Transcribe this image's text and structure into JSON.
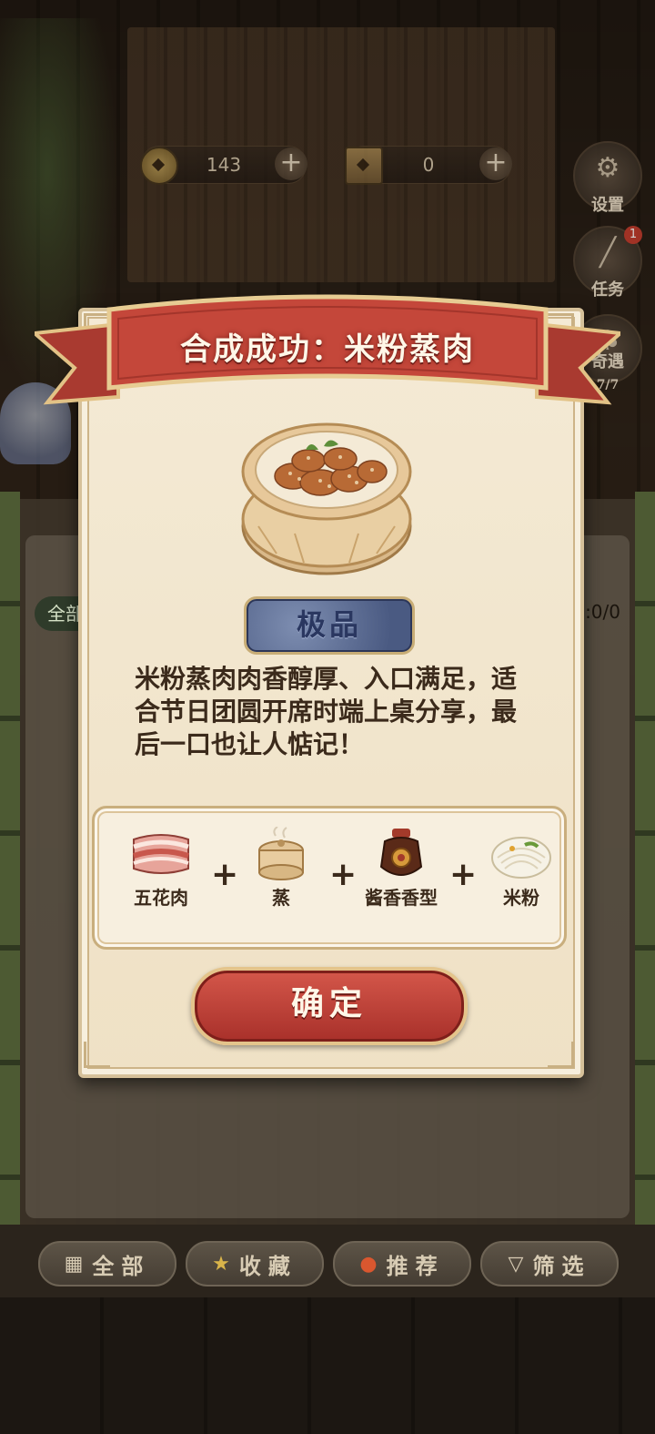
{
  "top_bar": {
    "coins": "143",
    "books": "0"
  },
  "side_buttons": {
    "settings_label": "设置",
    "tasks_label": "任务",
    "tasks_badge": "1",
    "encounter_label": "奇遇",
    "encounter_progress": "7/7"
  },
  "background_panel": {
    "tab_label": "全部",
    "count": ":0/0"
  },
  "modal": {
    "title": "合成成功：米粉蒸肉",
    "grade": "极品",
    "description": "米粉蒸肉肉香醇厚、入口满足，适合节日团圆开席时端上桌分享，最后一口也让人惦记！",
    "ingredients": [
      {
        "name": "五花肉",
        "icon": "pork-belly-icon"
      },
      {
        "name": "蒸",
        "icon": "steamer-icon"
      },
      {
        "name": "酱香香型",
        "icon": "sauce-jar-icon"
      },
      {
        "name": "米粉",
        "icon": "rice-noodle-icon"
      }
    ],
    "plus": "+",
    "confirm_label": "确定"
  },
  "bottom_tabs": [
    {
      "label": "全部",
      "icon": "grid-icon"
    },
    {
      "label": "收藏",
      "icon": "star-icon"
    },
    {
      "label": "推荐",
      "icon": "fire-icon"
    },
    {
      "label": "筛选",
      "icon": "filter-icon"
    }
  ],
  "colors": {
    "ribbon_red": "#c4473a",
    "parchment": "#f4ead5",
    "gold_border": "#d6c19a",
    "grade_blue": "#4a5a82",
    "text_brown": "#3b2a1b"
  }
}
